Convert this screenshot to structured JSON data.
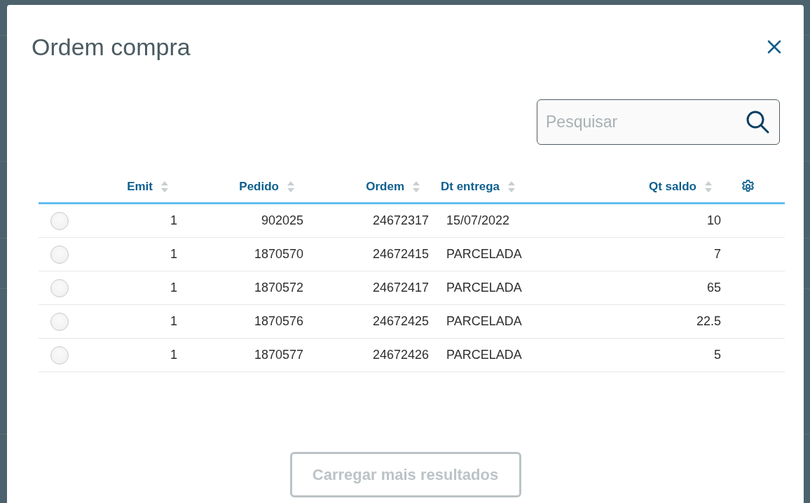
{
  "dialog": {
    "title": "Ordem compra"
  },
  "search": {
    "placeholder": "Pesquisar"
  },
  "table": {
    "columns": [
      {
        "label": "Emit",
        "kind": "number"
      },
      {
        "label": "Pedido",
        "kind": "number"
      },
      {
        "label": "Ordem",
        "kind": "number"
      },
      {
        "label": "Dt entrega",
        "kind": "text"
      },
      {
        "label": "Qt saldo",
        "kind": "number"
      }
    ],
    "rows": [
      {
        "selected": false,
        "cells": [
          "1",
          "902025",
          "24672317",
          "15/07/2022",
          "10"
        ]
      },
      {
        "selected": false,
        "cells": [
          "1",
          "1870570",
          "24672415",
          "PARCELADA",
          "7"
        ]
      },
      {
        "selected": false,
        "cells": [
          "1",
          "1870572",
          "24672417",
          "PARCELADA",
          "65"
        ]
      },
      {
        "selected": false,
        "cells": [
          "1",
          "1870576",
          "24672425",
          "PARCELADA",
          "22.5"
        ]
      },
      {
        "selected": false,
        "cells": [
          "1",
          "1870577",
          "24672426",
          "PARCELADA",
          "5"
        ]
      }
    ]
  },
  "load_more": {
    "label": "Carregar mais resultados",
    "disabled": true
  }
}
